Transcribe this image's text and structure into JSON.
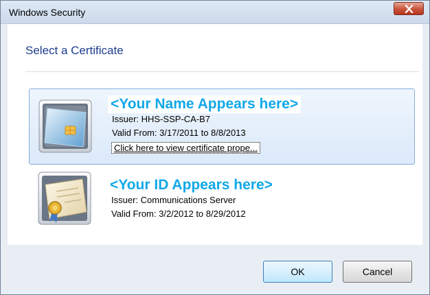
{
  "window": {
    "title": "Windows Security"
  },
  "dialog": {
    "heading": "Select a Certificate"
  },
  "certificates": [
    {
      "name": "<Your Name Appears here>",
      "issuer": "Issuer: HHS-SSP-CA-B7",
      "valid": "Valid From: 3/17/2011 to 8/8/2013",
      "link": "Click here to view certificate prope...",
      "icon": "smart-card-icon",
      "selected": true
    },
    {
      "name": "<Your ID Appears here>",
      "issuer": "Issuer: Communications Server",
      "valid": "Valid From: 3/2/2012 to 8/29/2012",
      "icon": "certificate-icon",
      "selected": false
    }
  ],
  "buttons": {
    "ok": "OK",
    "cancel": "Cancel"
  },
  "colors": {
    "accent_name": "#11a8e8",
    "heading": "#1e3d8f",
    "close": "#c9533b"
  }
}
